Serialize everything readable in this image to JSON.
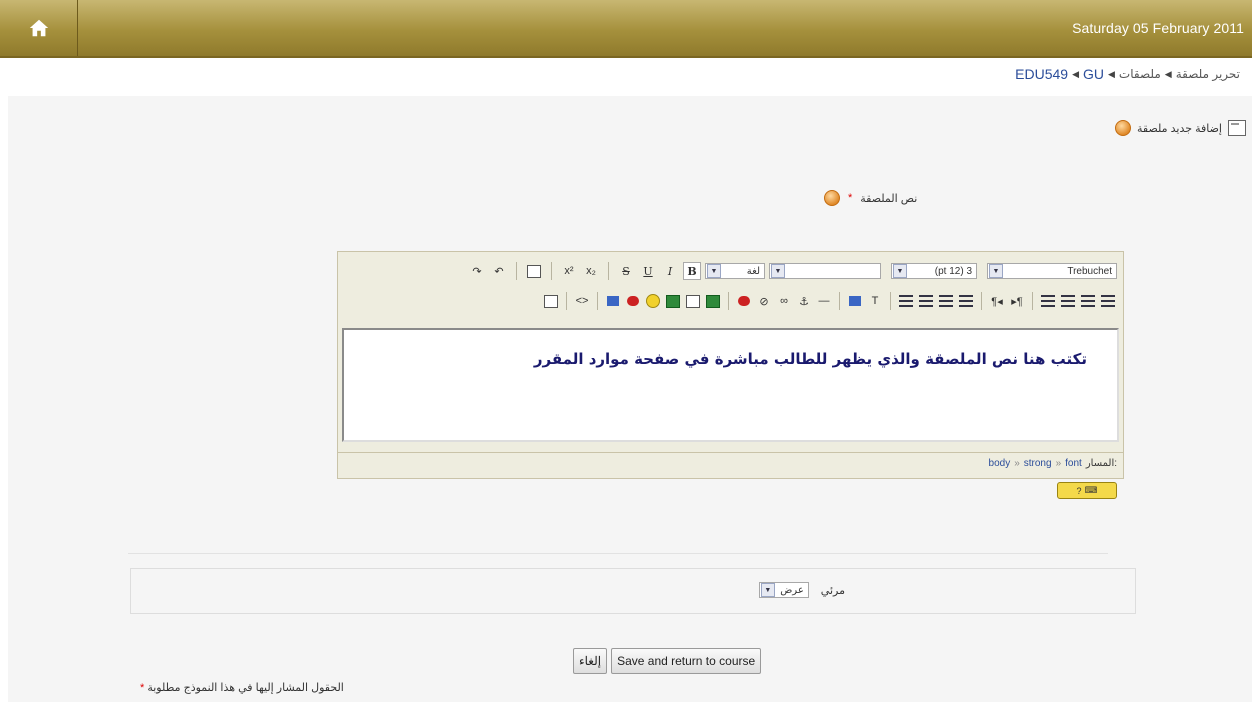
{
  "header": {
    "date": "Saturday 05 February 2011",
    "home_icon": "home-icon"
  },
  "breadcrumb": {
    "items": [
      "EDU549",
      "GU",
      "ملصقات",
      "تحرير ملصقة"
    ]
  },
  "page": {
    "heading": "إضافة جديد ملصقة"
  },
  "form": {
    "text_label": "نص الملصقة",
    "required_mark": "*",
    "editor": {
      "font_family": "Trebuchet",
      "font_size": "3 (12 pt)",
      "lang": "لغة",
      "content": "تكتب هنا نص الملصقة والذي يظهر للطالب مباشرة في صفحة موارد المقرر",
      "path_label": "المسار:",
      "path": [
        "body",
        "strong",
        "font"
      ]
    },
    "visibility_label": "مرئي",
    "visibility_value": "عرض"
  },
  "buttons": {
    "cancel": "إلغاء",
    "save": "Save and return to course"
  },
  "footer": {
    "required_note": "الحقول المشار إليها في هذا النموذج مطلوبة",
    "required_mark": "*"
  },
  "colors": {
    "header": "#a5903c",
    "link": "#2b4d9a",
    "editor_text": "#1a1a6e"
  }
}
